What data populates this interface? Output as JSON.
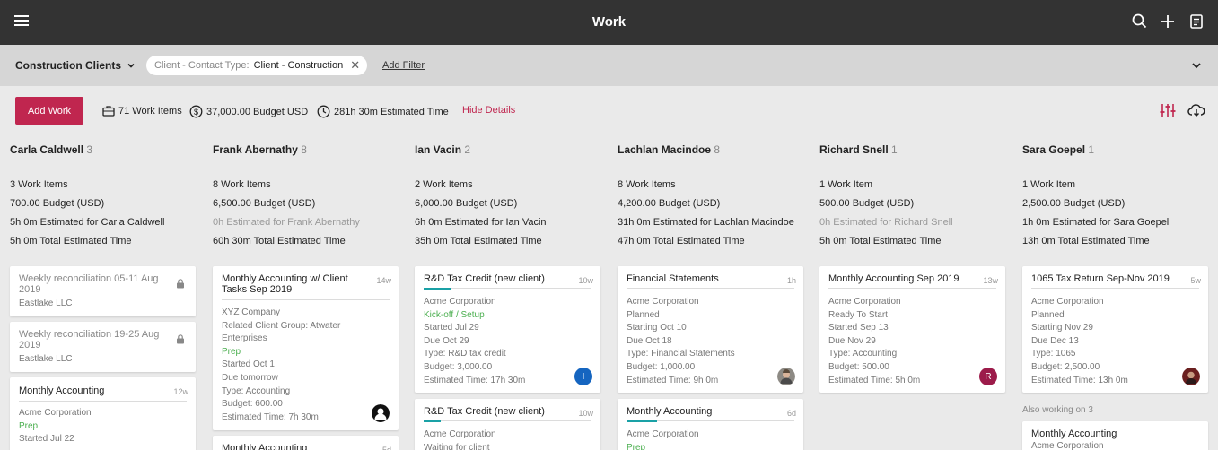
{
  "header": {
    "title": "Work"
  },
  "filter": {
    "view_name": "Construction Clients",
    "chip_key": "Client - Contact Type:",
    "chip_value": "Client - Construction",
    "add_filter": "Add Filter"
  },
  "toolbar": {
    "add_work": "Add Work",
    "work_items": "71 Work Items",
    "budget": "37,000.00 Budget USD",
    "time": "281h 30m Estimated Time",
    "hide_details": "Hide Details"
  },
  "colors": {
    "accent": "#c0264f",
    "status_green": "#4caf50",
    "progress": "#1aa1a6",
    "topbar": "#333333"
  },
  "columns": [
    {
      "name": "Carla Caldwell",
      "count": "3",
      "summary": [
        "3 Work Items",
        "700.00 Budget (USD)",
        "5h 0m Estimated for Carla Caldwell",
        "5h 0m Total Estimated Time"
      ]
    },
    {
      "name": "Frank Abernathy",
      "count": "8",
      "summary": [
        "8 Work Items",
        "6,500.00 Budget (USD)",
        "0h Estimated for Frank Abernathy",
        "60h 30m Total Estimated Time"
      ]
    },
    {
      "name": "Ian Vacin",
      "count": "2",
      "summary": [
        "2 Work Items",
        "6,000.00 Budget (USD)",
        "6h 0m Estimated for Ian Vacin",
        "35h 0m Total Estimated Time"
      ]
    },
    {
      "name": "Lachlan Macindoe",
      "count": "8",
      "summary": [
        "8 Work Items",
        "4,200.00 Budget (USD)",
        "31h 0m Estimated for Lachlan Macindoe",
        "47h 0m Total Estimated Time"
      ]
    },
    {
      "name": "Richard Snell",
      "count": "1",
      "summary": [
        "1 Work Item",
        "500.00 Budget (USD)",
        "0h Estimated for Richard Snell",
        "5h 0m Total Estimated Time"
      ]
    },
    {
      "name": "Sara Goepel",
      "count": "1",
      "summary": [
        "1 Work Item",
        "2,500.00 Budget (USD)",
        "1h 0m Estimated for Sara Goepel",
        "13h 0m Total Estimated Time"
      ]
    }
  ],
  "cards": {
    "c1a": {
      "title": "Weekly reconciliation 05-11 Aug 2019",
      "client": "Eastlake LLC"
    },
    "c1b": {
      "title": "Weekly reconciliation 19-25 Aug 2019",
      "client": "Eastlake LLC"
    },
    "c1c": {
      "title": "Monthly Accounting",
      "age": "12w",
      "client": "Acme Corporation",
      "status": "Prep",
      "started": "Started Jul 22"
    },
    "c2a": {
      "title": "Monthly Accounting w/ Client Tasks Sep 2019",
      "age": "14w",
      "client": "XYZ Company",
      "group1": "Related Client Group: Atwater",
      "group2": "Enterprises",
      "status": "Prep",
      "started": "Started Oct 1",
      "due": "Due tomorrow",
      "type": "Type: Accounting",
      "budget": "Budget: 600.00",
      "est": "Estimated Time: 7h 30m"
    },
    "c2b": {
      "title": "Monthly Accounting",
      "age": "5d"
    },
    "c3a": {
      "title": "R&D Tax Credit (new client)",
      "age": "10w",
      "progress": 0.16,
      "client": "Acme Corporation",
      "status": "Kick-off / Setup",
      "started": "Started Jul 29",
      "due": "Due Oct 29",
      "type": "Type: R&D tax credit",
      "budget": "Budget: 3,000.00",
      "est": "Estimated Time: 17h 30m",
      "avatar": "I"
    },
    "c3b": {
      "title": "R&D Tax Credit (new client)",
      "age": "10w",
      "progress": 0.1,
      "client": "Acme Corporation",
      "status": "Waiting for client"
    },
    "c4a": {
      "title": "Financial Statements",
      "age": "1h",
      "client": "Acme Corporation",
      "status": "Planned",
      "started": "Starting Oct 10",
      "due": "Due Oct 18",
      "type": "Type: Financial Statements",
      "budget": "Budget: 1,000.00",
      "est": "Estimated Time: 9h 0m"
    },
    "c4b": {
      "title": "Monthly Accounting",
      "age": "6d",
      "progress": 0.18,
      "client": "Acme Corporation",
      "status": "Prep"
    },
    "c5a": {
      "title": "Monthly Accounting Sep 2019",
      "age": "13w",
      "client": "Acme Corporation",
      "status": "Ready To Start",
      "started": "Started Sep 13",
      "due": "Due Nov 29",
      "type": "Type: Accounting",
      "budget": "Budget: 500.00",
      "est": "Estimated Time: 5h 0m",
      "avatar": "R"
    },
    "c6a": {
      "title": "1065 Tax Return Sep-Nov 2019",
      "age": "5w",
      "client": "Acme Corporation",
      "status": "Planned",
      "started": "Starting Nov 29",
      "due": "Due Dec 13",
      "type": "Type: 1065",
      "budget": "Budget: 2,500.00",
      "est": "Estimated Time: 13h 0m"
    },
    "also": {
      "label": "Also working on",
      "count": "3"
    },
    "c6b": {
      "title": "Monthly Accounting",
      "client": "Acme Corporation"
    }
  }
}
